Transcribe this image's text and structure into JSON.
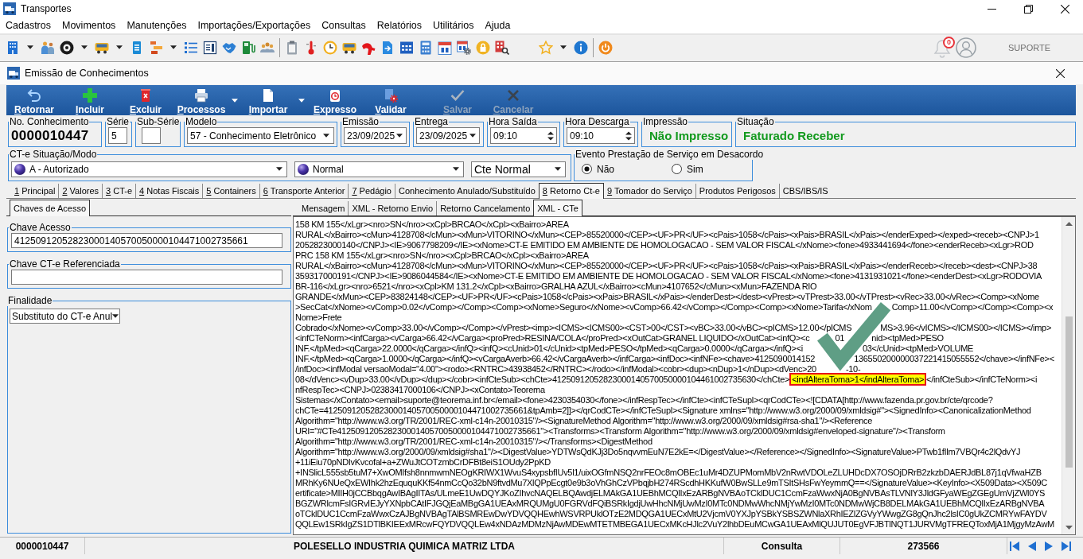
{
  "window": {
    "title": "Transportes"
  },
  "menu": [
    "Cadastros",
    "Movimentos",
    "Manutenções",
    "Importações/Exportações",
    "Consultas",
    "Relatórios",
    "Utilitários",
    "Ajuda"
  ],
  "toolbar": {
    "notifications": "0",
    "user": "SUPORTE"
  },
  "form_window": {
    "title": "Emissão de Conhecimentos"
  },
  "actions": [
    {
      "label": "Retornar",
      "disabled": false,
      "dropdown": false
    },
    {
      "label": "Incluir",
      "disabled": false,
      "dropdown": false
    },
    {
      "label": "Excluir",
      "disabled": false,
      "dropdown": false
    },
    {
      "label": "Processos",
      "disabled": false,
      "dropdown": true
    },
    {
      "label": "Importar",
      "disabled": false,
      "dropdown": true
    },
    {
      "label": "Expresso",
      "disabled": false,
      "dropdown": false
    },
    {
      "label": "Validar",
      "disabled": false,
      "dropdown": false
    },
    {
      "label": "Salvar",
      "disabled": true,
      "dropdown": false
    },
    {
      "label": "Cancelar",
      "disabled": true,
      "dropdown": false
    }
  ],
  "header_fields": [
    {
      "kind": "number",
      "label": "No. Conhecimento",
      "value": "0000010447"
    },
    {
      "kind": "input",
      "label": "Série",
      "value": "5"
    },
    {
      "kind": "input",
      "label": "Sub-Série"
    },
    {
      "kind": "select",
      "label": "Modelo",
      "value": "57 - Conhecimento Eletrônico"
    },
    {
      "kind": "date",
      "label": "Emissão",
      "value": "23/09/2025"
    },
    {
      "kind": "date",
      "label": "Entrega",
      "value": "23/09/2025"
    },
    {
      "kind": "time",
      "label": "Hora Saída",
      "value": "09:10"
    },
    {
      "kind": "time",
      "label": "Hora Descarga",
      "value": "09:10"
    },
    {
      "kind": "status",
      "label": "Impressão",
      "value": "Não Impresso"
    },
    {
      "kind": "status",
      "label": "Situação",
      "value": "Faturado Receber"
    }
  ],
  "situacao_modo": {
    "label": "CT-e Situação/Modo",
    "selects": [
      {
        "kind": "icon",
        "value": "A - Autorizado"
      },
      {
        "kind": "icon",
        "value": "Normal"
      },
      {
        "kind": "plain",
        "value": "Cte Normal"
      }
    ]
  },
  "evento": {
    "label": "Evento Prestação de Serviço em Desacordo",
    "options": [
      {
        "label": "Não",
        "selected": true
      },
      {
        "label": "Sim",
        "selected": false
      }
    ]
  },
  "tabs": [
    {
      "key": "1",
      "label": "Principal",
      "selected": false
    },
    {
      "key": "2",
      "label": "Valores",
      "selected": false
    },
    {
      "key": "3",
      "label": "CT-e",
      "selected": false
    },
    {
      "key": "4",
      "label": "Notas Fiscais",
      "selected": false
    },
    {
      "key": "5",
      "label": "Containers",
      "selected": false
    },
    {
      "key": "6",
      "label": "Transporte Anterior",
      "selected": false
    },
    {
      "key": "7",
      "label": "Pedágio",
      "selected": false
    },
    {
      "label": "Conhecimento Anulado/Substituído",
      "selected": false
    },
    {
      "key": "8",
      "label": "Retorno Ct-e",
      "selected": true
    },
    {
      "key": "9",
      "label": "Tomador do Serviço",
      "selected": false
    },
    {
      "label": "Produtos Perigosos",
      "selected": false
    },
    {
      "label": "CBS/IBS/IS",
      "selected": false
    }
  ],
  "left_tabs": [
    {
      "label": "Chaves de Acesso",
      "selected": true
    }
  ],
  "left_groups": [
    {
      "kind": "input",
      "label": "Chave Acesso",
      "value": "41250912052823000140570050000104471002735661"
    },
    {
      "kind": "input",
      "label": "Chave CT-e Referenciada"
    },
    {
      "kind": "select",
      "label": "Finalidade",
      "value": "Substituto do CT-e Anul"
    }
  ],
  "xml_tabs": [
    {
      "label": "Mensagem",
      "selected": false
    },
    {
      "label": "XML - Retorno Envio",
      "selected": false
    },
    {
      "label": "Retorno Cancelamento",
      "selected": false
    },
    {
      "label": "XML - CTe",
      "selected": true
    }
  ],
  "xml_lines": [
    [
      {
        "text": "158 KM 155</xLgr><nro>SN</nro><xCpl>BRCAO</xCpl><xBairro>AREA",
        "highlighted": false
      }
    ],
    [
      {
        "text": "RURAL</xBairro><cMun>4128708</cMun><xMun>VITORINO</xMun><CEP>85520000</CEP><UF>PR</UF><cPais>1058</cPais><xPais>BRASIL</xPais></enderExped></exped><receb><CNPJ>1",
        "highlighted": false
      }
    ],
    [
      {
        "text": "2052823000140</CNPJ><IE>9067798209</IE><xNome>CT-E EMITIDO EM AMBIENTE DE HOMOLOGACAO - SEM VALOR FISCAL</xNome><fone>4933441694</fone><enderReceb><xLgr>ROD",
        "highlighted": false
      }
    ],
    [
      {
        "text": "PRC 158 KM 155</xLgr><nro>SN</nro><xCpl>BRCAO</xCpl><xBairro>AREA",
        "highlighted": false
      }
    ],
    [
      {
        "text": "RURAL</xBairro><cMun>4128708</cMun><xMun>VITORINO</xMun><CEP>85520000</CEP><UF>PR</UF><cPais>1058</cPais><xPais>BRASIL</xPais></enderReceb></receb><dest><CNPJ>38",
        "highlighted": false
      }
    ],
    [
      {
        "text": "359317000191</CNPJ><IE>9086044584</IE><xNome>CT-E EMITIDO EM AMBIENTE DE HOMOLOGACAO - SEM VALOR FISCAL</xNome><fone>4131931021</fone><enderDest><xLgr>RODOVIA",
        "highlighted": false
      }
    ],
    [
      {
        "text": "BR-116</xLgr><nro>6521</nro><xCpl>KM 131.2</xCpl><xBairro>GRALHA AZUL</xBairro><cMun>4107652</cMun><xMun>FAZENDA RIO",
        "highlighted": false
      }
    ],
    [
      {
        "text": "GRANDE</xMun><CEP>83824148</CEP><UF>PR</UF><cPais>1058</cPais><xPais>BRASIL</xPais></enderDest></dest><vPrest><vTPrest>33.00</vTPrest><vRec>33.00</vRec><Comp><xNome",
        "highlighted": false
      }
    ],
    [
      {
        "text": ">SecCat</xNome><vComp>0.02</vComp></Comp><Comp><xNome>Seguro</xNome><vComp>66.42</vComp></Comp><Comp><xNome>Tarifa</xNom",
        "highlighted": false
      },
      {
        "text": "Comp>11.00</vComp></Comp><Comp><x",
        "highlighted": false
      }
    ],
    [
      {
        "text": "Nome>Frete",
        "highlighted": false
      }
    ],
    [
      {
        "text": "Cobrado</xNome><vComp>33.00</vComp></Comp></vPrest><imp><ICMS><ICMS00><CST>00</CST><vBC>33.00</vBC><pICMS>12.00</pICMS",
        "highlighted": false
      },
      {
        "text": "MS>3.96</vICMS></ICMS00></ICMS></imp>",
        "highlighted": false
      }
    ],
    [
      {
        "text": "<infCTeNorm><infCarga><vCarga>66.42</vCarga><proPred>RESINA/COLA</proPred><xOutCat>GRANEL LIQUIDO</xOutCat><infQ><c",
        "highlighted": false
      },
      {
        "text": "01",
        "highlighted": false
      },
      {
        "text": "nid><tpMed>PESO",
        "highlighted": false
      }
    ],
    [
      {
        "text": "INF.</tpMed><qCarga>22.0000</qCarga></infQ><infQ><cUnid>01</cUnid><tpMed>PESO</tpMed><qCarga>0.0000</qCarga></infQ><i",
        "highlighted": false
      },
      {
        "text": "03</cUnid><tpMed>VOLUME",
        "highlighted": false
      }
    ],
    [
      {
        "text": "INF.</tpMed><qCarga>1.0000</qCarga></infQ><vCargaAverb>66.42</vCargaAverb></infCarga><infDoc><infNFe><chave>4125090014152",
        "highlighted": false
      },
      {
        "text": "136550200000037221415055552</chave></infNFe><",
        "highlighted": false
      }
    ],
    [
      {
        "text": "/infDoc><infModal versaoModal=\"4.00\"><rodo><RNTRC>43938452</RNTRC></rodo></infModal><cobr><dup><nDup>1</nDup><dVenc>20",
        "highlighted": false
      },
      {
        "text": "-10-",
        "highlighted": false
      }
    ],
    [
      {
        "text": "08</dVenc><vDup>33.00</vDup></dup></cobr><infCteSub><chCte>41250912052823000140570050000104461002735630</chCte>",
        "highlighted": false
      },
      {
        "text": "<indAlteraToma>1</indAlteraToma>",
        "highlighted": true
      },
      {
        "text": "</infCteSub></infCTeNorm><i",
        "highlighted": false
      }
    ],
    [
      {
        "text": "nfRespTec><CNPJ>02383417000106</CNPJ><xContato>Teorema",
        "highlighted": false
      }
    ],
    [
      {
        "text": "Sistemas</xContato><email>suporte@teorema.inf.br</email><fone>4230354030</fone></infRespTec></infCte><infCTeSupl><qrCodCTe><![CDATA[http://www.fazenda.pr.gov.br/cte/qrcode?",
        "highlighted": false
      }
    ],
    [
      {
        "text": "chCTe=41250912052823000140570050000104471002735661&tpAmb=2]]></qrCodCTe></infCTeSupl><Signature xmlns=\"http://www.w3.org/2000/09/xmldsig#\"><SignedInfo><CanonicalizationMethod",
        "highlighted": false
      }
    ],
    [
      {
        "text": "Algorithm=\"http://www.w3.org/TR/2001/REC-xml-c14n-20010315\"/><SignatureMethod Algorithm=\"http://www.w3.org/2000/09/xmldsig#rsa-sha1\"/><Reference",
        "highlighted": false
      }
    ],
    [
      {
        "text": "URI=\"#CTe41250912052823000140570050000104471002735661\"><Transforms><Transform Algorithm=\"http://www.w3.org/2000/09/xmldsig#enveloped-signature\"/><Transform",
        "highlighted": false
      }
    ],
    [
      {
        "text": "Algorithm=\"http://www.w3.org/TR/2001/REC-xml-c14n-20010315\"/></Transforms><DigestMethod",
        "highlighted": false
      }
    ],
    [
      {
        "text": "Algorithm=\"http://www.w3.org/2000/09/xmldsig#sha1\"/><DigestValue>YDTWsQdKJj3Do5nqvvmEuN7E2kE=</DigestValue></Reference></SignedInfo><SignatureValue>PTwb1fIlm7VBQr4c2lQdvYJ",
        "highlighted": false
      }
    ],
    [
      {
        "text": "+11iEiu70pNDIvKvcofal+a+ZWuJtCOTzmbCrDFBt8eiS1OUdy2PpKD",
        "highlighted": false
      }
    ],
    [
      {
        "text": "+INSlicL555sb5tuM7+XwOMIfsh8nnmwmNEOgKRIWX1WvuS4xypsbfIUv5l1/uixOGfmNSQ2nrFEOc8mOBEc1uMr4DZUPMomMbV2nRwtVDOLeZLUHDcDX7OSOjDRrB2zkzbDAERJdBL87j1qVfwaHZB",
        "highlighted": false
      }
    ],
    [
      {
        "text": "MRhKy6NUeQxEWIhk2hzEququKKf54nmCcQo32bN9ftvdMu7XlQPpEcgt0e9b3oVhGhCzVPbqjbH274RScdhHKKufW0BwSLLe9mTSItSHsFwYeymmQ==</SignatureValue><KeyInfo><X509Data><X509C",
        "highlighted": false
      }
    ],
    [
      {
        "text": "ertificate>MIIH0jCCBbqgAwIBAgIITAs/ULmeE1UwDQYJKoZIhvcNAQELBQAwdjELMAkGA1UEBhMCQlIxEzARBgNVBAoTCklDUC1CcmFzaWwxNjA0BgNVBAsTLVNlY3JldGFyaWEgZGEgUmVjZWl0YS",
        "highlighted": false
      }
    ],
    [
      {
        "text": "BGZWRlcmFsIGRvIEJyYXNpbCAtIFJGQjEaMBgGA1UEAxMRQUMgU0FGRVdFQiBSRkIgdjUwHhcNMjUwMzI0MTc0NDMwWhcNMjYwMzI0MTc0NDMwWjCB8DELMAkGA1UEBhMCQlIxEzARBgNVBA",
        "highlighted": false
      }
    ],
    [
      {
        "text": "oTCklDUC1CcmFzaWwxCzAJBgNVBAgTAlBSMREwDwYDVQQHEwhWSVRPUklOTzE2MDQGA1UECxMtU2VjcmV0YXJpYSBkYSBSZWNlaXRhIEZlZGVyYWwgZG8gQnJhc2lsIC0gUkZCMRYwFAYDV",
        "highlighted": false
      }
    ],
    [
      {
        "text": "QQLEw1SRkIgZS1DTlBKIEExMRcwFQYDVQQLEw4xNDAzMDMzNjAwMDEwMTETMBEGA1UECxMKcHJlc2VuY2lhbDEuMCwGA1UEAxMlQUJUT0EgVFJBTlNQT1JURVMgTFREQToxMjA1MjgyMzAwM",
        "highlighted": false
      }
    ]
  ],
  "status_bar": [
    "0000010447",
    "POLESELLO INDUSTRIA QUIMICA MATRIZ LTDA",
    "Consulta",
    "273566"
  ]
}
